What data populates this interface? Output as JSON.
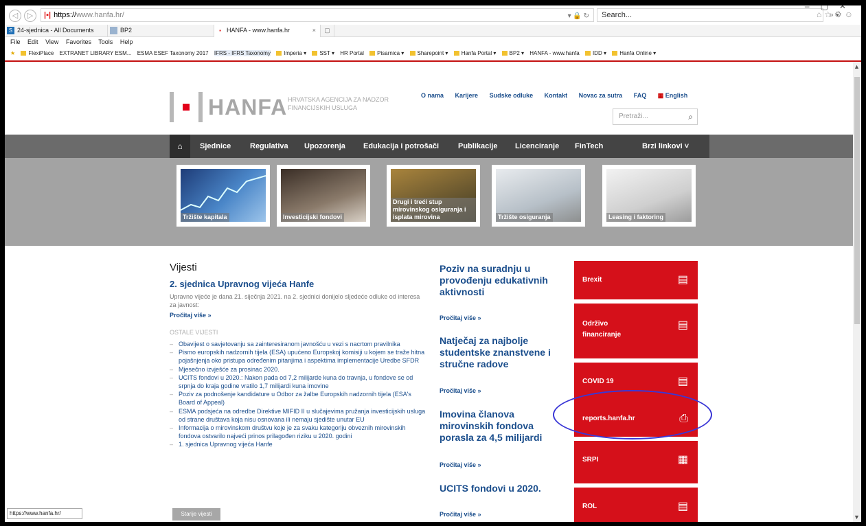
{
  "browser": {
    "url_prefix": "https://",
    "url_host": "www.hanfa.hr/",
    "search_placeholder": "Search...",
    "tabs": [
      {
        "label": "24-sjednica - All Documents"
      },
      {
        "label": "BP2"
      },
      {
        "label": "HANFA - www.hanfa.hr"
      }
    ],
    "menu": [
      "File",
      "Edit",
      "View",
      "Favorites",
      "Tools",
      "Help"
    ],
    "favorites": [
      "FlexiPlace",
      "EXTRANET LIBRARY ESM...",
      "ESMA ESEF Taxonomy 2017",
      "IFRS - IFRS Taxonomy",
      "Imperia ▾",
      "SST ▾",
      "HR Portal",
      "Pisarnica ▾",
      "Sharepoint ▾",
      "Hanfa Portal ▾",
      "BP2 ▾",
      "HANFA - www.hanfa",
      "IDD ▾",
      "Hanfa Online ▾"
    ],
    "status_url": "https://www.hanfa.hr/"
  },
  "site": {
    "logo": "HANFA",
    "tagline": "HRVATSKA AGENCIJA ZA NADZOR FINANCIJSKIH USLUGA",
    "top_links": [
      "O nama",
      "Karijere",
      "Sudske odluke",
      "Kontakt",
      "Novac za sutra",
      "FAQ",
      "English"
    ],
    "search_placeholder": "Pretraži...",
    "nav": [
      "Sjednice",
      "Regulativa",
      "Upozorenja",
      "Edukacija i potrošači",
      "Publikacije",
      "Licenciranje",
      "FinTech",
      "Brzi linkovi ˅"
    ],
    "tiles": [
      "Tržište kapitala",
      "Investicijski fondovi",
      "Drugi i treći stup mirovinskog osiguranja i isplata mirovina",
      "Tržište osiguranja",
      "Leasing i faktoring"
    ]
  },
  "news": {
    "heading": "Vijesti",
    "lead_title": "2. sjednica Upravnog vijeća Hanfe",
    "lead_text": "Upravno vijeće je dana 21. siječnja 2021. na 2. sjednici donijelo sljedeće odluke od interesa za javnost:",
    "read_more": "Pročitaj više »",
    "other_heading": "OSTALE VIJESTI",
    "items": [
      "Obavijest o savjetovanju sa zainteresiranom javnošću u vezi s nacrtom pravilnika",
      "Pismo europskih nadzornih tijela (ESA) upućeno Europskoj komisiji u kojem se traže hitna pojašnjenja oko pristupa određenim pitanjima i aspektima implementacije Uredbe SFDR",
      "Mjesečno izvješće za prosinac 2020.",
      "UCITS fondovi u 2020.: Nakon pada od 7,2 milijarde kuna do travnja, u fondove se od srpnja do kraja godine vratilo 1,7 milijardi kuna imovine",
      "Poziv za podnošenje kandidature u Odbor za žalbe Europskih nadzornih tijela (ESA's Board of Appeal)",
      "ESMA podsjeća na odredbe Direktive MIFID II u slučajevima pružanja investicijskih usluga od strane društava koja nisu osnovana ili nemaju sjedište unutar EU",
      "Informacija o mirovinskom društvu koje je za svaku kategoriju obveznih mirovinskih fondova ostvarilo najveći prinos prilagođen riziku u 2020. godini",
      "1. sjednica Upravnog vijeća Hanfe"
    ],
    "older_button": "Starije vijesti"
  },
  "featured": [
    {
      "title": "Poziv na suradnju u provođenju edukativnih aktivnosti",
      "more": "Pročitaj više »"
    },
    {
      "title": "Natječaj za najbolje studentske znanstvene i stručne radove",
      "more": "Pročitaj više »"
    },
    {
      "title": "Imovina članova mirovinskih fondova porasla za 4,5 milijardi",
      "more": "Pročitaj više »"
    },
    {
      "title": "UCITS fondovi u 2020.",
      "more": "Pročitaj više »"
    }
  ],
  "quick_cards": [
    {
      "label": "Brexit",
      "icon": "document-icon"
    },
    {
      "label": "Održivo financiranje",
      "icon": "document-icon"
    },
    {
      "label": "COVID 19",
      "icon": "document-icon"
    },
    {
      "label": "reports.hanfa.hr",
      "icon": "inbox-icon"
    },
    {
      "label": "SRPI",
      "icon": "cabinet-icon"
    },
    {
      "label": "ROL",
      "icon": "document-icon"
    }
  ],
  "colors": {
    "brand_red": "#d5101a",
    "link_blue": "#1b4e8c",
    "annotation_circle": "#3a37d6"
  }
}
